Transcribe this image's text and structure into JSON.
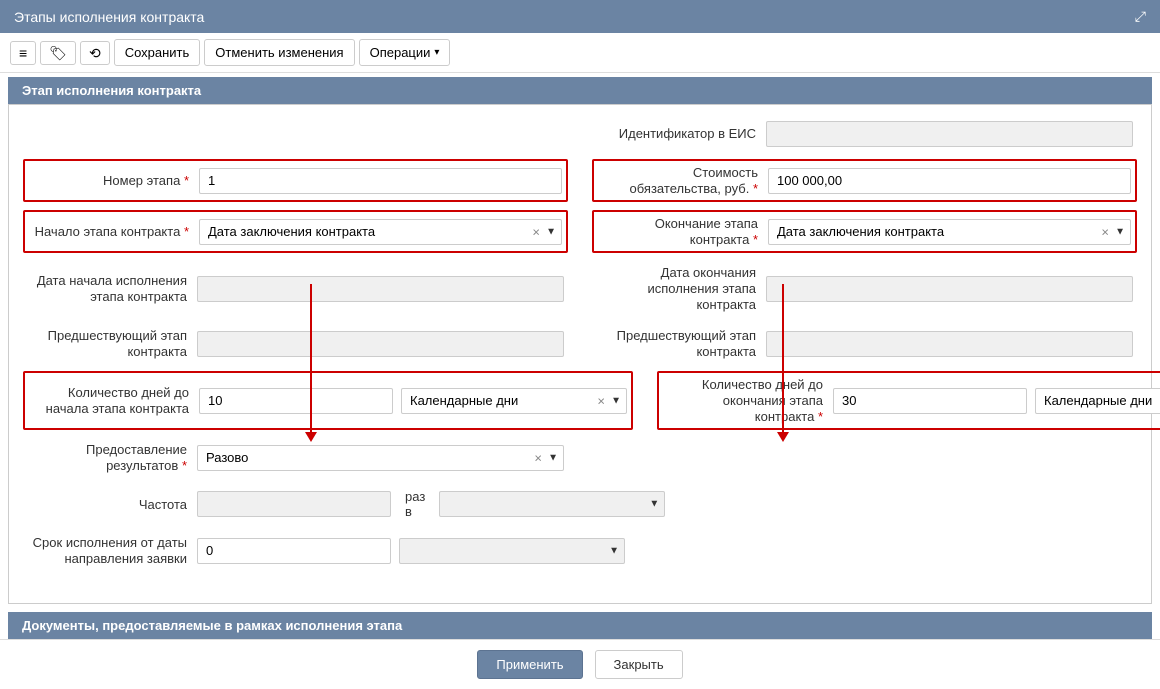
{
  "window": {
    "title": "Этапы исполнения контракта"
  },
  "toolbar": {
    "save": "Сохранить",
    "cancel": "Отменить изменения",
    "operations": "Операции"
  },
  "section": {
    "title": "Этап исполнения контракта"
  },
  "fields": {
    "eis_id": {
      "label": "Идентификатор в ЕИС",
      "value": ""
    },
    "stage_number": {
      "label": "Номер этапа",
      "value": "1"
    },
    "obligation_cost": {
      "label": "Стоимость обязательства, руб.",
      "value": "100 000,00"
    },
    "contract_start": {
      "label": "Начало этапа контракта",
      "value": "Дата заключения контракта"
    },
    "contract_end": {
      "label": "Окончание этапа контракта",
      "value": "Дата заключения контракта"
    },
    "exec_start": {
      "label": "Дата начала исполнения этапа контракта",
      "value": ""
    },
    "exec_end": {
      "label": "Дата окончания исполнения этапа контракта",
      "value": ""
    },
    "prev_stage_l": {
      "label": "Предшествующий этап контракта",
      "value": ""
    },
    "prev_stage_r": {
      "label": "Предшествующий этап контракта",
      "value": ""
    },
    "days_to_start": {
      "label": "Количество дней до начала этапа контракта",
      "value": "10",
      "unit": "Календарные дни"
    },
    "days_to_end": {
      "label": "Количество дней до окончания этапа контракта",
      "value": "30",
      "unit": "Календарные дни"
    },
    "results": {
      "label": "Предоставление результатов",
      "value": "Разово"
    },
    "frequency": {
      "label": "Частота",
      "value": "",
      "raz_v": "раз в",
      "unit": ""
    },
    "exec_period": {
      "label": "Срок исполнения от даты направления заявки",
      "value": "0",
      "unit": ""
    }
  },
  "section2": {
    "title": "Документы, предоставляемые в рамках исполнения этапа"
  },
  "footer": {
    "apply": "Применить",
    "close": "Закрыть"
  }
}
